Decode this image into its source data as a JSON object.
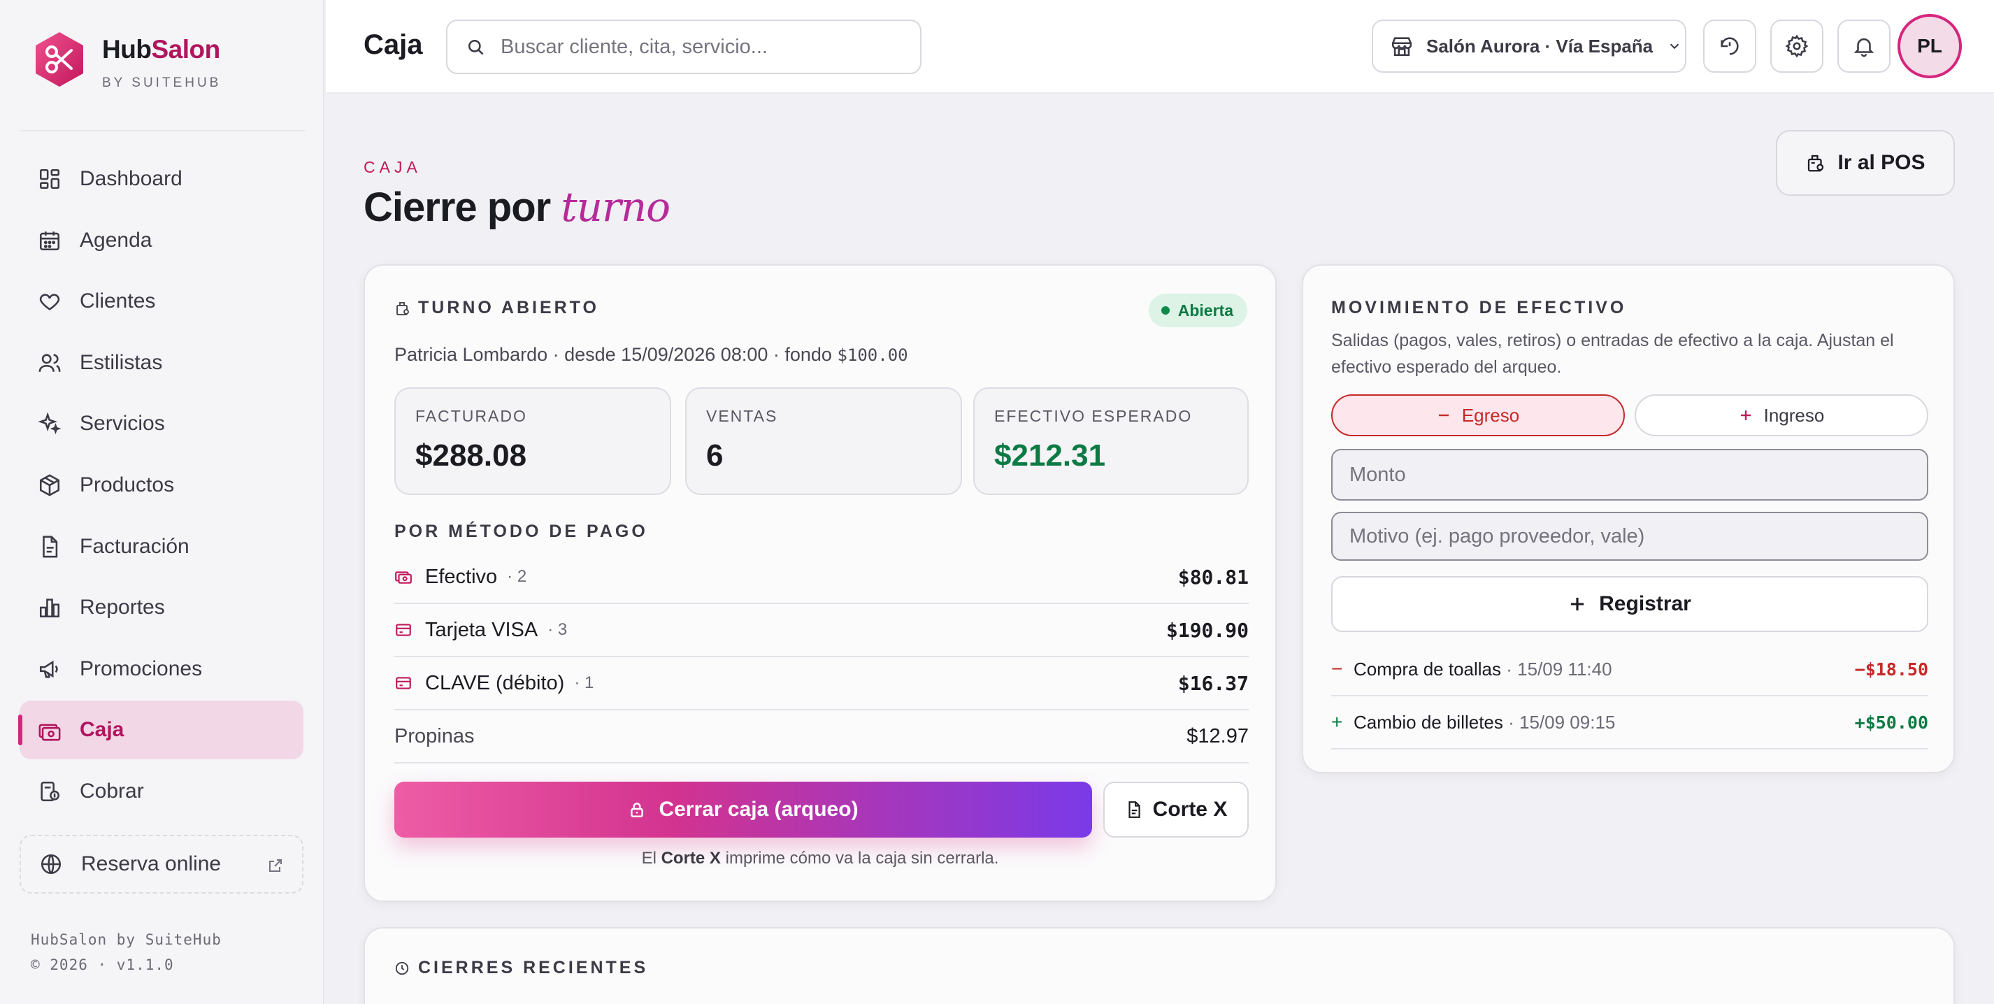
{
  "brand": {
    "name_part1": "Hub",
    "name_part2": "Salon",
    "sub": "BY SUITEHUB"
  },
  "nav": [
    {
      "label": "Dashboard",
      "icon": "dashboard-icon"
    },
    {
      "label": "Agenda",
      "icon": "calendar-icon"
    },
    {
      "label": "Clientes",
      "icon": "heart-icon"
    },
    {
      "label": "Estilistas",
      "icon": "users-icon"
    },
    {
      "label": "Servicios",
      "icon": "sparkles-icon"
    },
    {
      "label": "Productos",
      "icon": "box-icon"
    },
    {
      "label": "Facturación",
      "icon": "document-icon"
    },
    {
      "label": "Reportes",
      "icon": "bar-chart-icon"
    },
    {
      "label": "Promociones",
      "icon": "megaphone-icon"
    },
    {
      "label": "Caja",
      "icon": "cash-register-icon",
      "active": true
    },
    {
      "label": "Cobrar",
      "icon": "coins-icon"
    }
  ],
  "reserve": {
    "label": "Reserva online"
  },
  "footer": {
    "line1": "HubSalon by SuiteHub",
    "line2": "© 2026 · v1.1.0"
  },
  "topbar": {
    "title": "Caja",
    "search_placeholder": "Buscar cliente, cita, servicio...",
    "location": "Salón Aurora · Vía España",
    "avatar": "PL"
  },
  "page": {
    "eyebrow": "CAJA",
    "title_main": "Cierre por",
    "title_accent": "turno",
    "pos_button": "Ir al POS"
  },
  "turno": {
    "label": "TURNO ABIERTO",
    "status": "Abierta",
    "subtitle": "Patricia Lombardo · desde 15/09/2026 08:00 · fondo",
    "fondo": "$100.00",
    "stats": [
      {
        "label": "FACTURADO",
        "value": "$288.08"
      },
      {
        "label": "VENTAS",
        "value": "6"
      },
      {
        "label": "EFECTIVO ESPERADO",
        "value": "$212.31"
      }
    ],
    "methods_title": "POR MÉTODO DE PAGO",
    "methods": [
      {
        "name": "Efectivo",
        "count": "· 2",
        "amount": "$80.81"
      },
      {
        "name": "Tarjeta VISA",
        "count": "· 3",
        "amount": "$190.90"
      },
      {
        "name": "CLAVE (débito)",
        "count": "· 1",
        "amount": "$16.37"
      }
    ],
    "tips": {
      "label": "Propinas",
      "amount": "$12.97"
    },
    "close_button": "Cerrar caja (arqueo)",
    "cortex_button": "Corte X",
    "hint_prefix": "El",
    "hint_bold": "Corte X",
    "hint_suffix": "imprime cómo va la caja sin cerrarla."
  },
  "movement": {
    "title": "MOVIMIENTO DE EFECTIVO",
    "description": "Salidas (pagos, vales, retiros) o entradas de efectivo a la caja. Ajustan el efectivo esperado del arqueo.",
    "egreso": "Egreso",
    "ingreso": "Ingreso",
    "amount_placeholder": "Monto",
    "reason_placeholder": "Motivo (ej. pago proveedor, vale)",
    "register": "Registrar",
    "items": [
      {
        "sign": "−",
        "title": "Compra de toallas",
        "meta": "· 15/09 11:40",
        "amount": "−$18.50"
      },
      {
        "sign": "+",
        "title": "Cambio de billetes",
        "meta": "· 15/09 09:15",
        "amount": "+$50.00"
      }
    ]
  },
  "cierres": {
    "title": "CIERRES RECIENTES"
  },
  "colors": {
    "brand": "#b0155d",
    "accent_pink": "#d6257c",
    "success": "#0c7a43",
    "danger": "#c62828"
  }
}
